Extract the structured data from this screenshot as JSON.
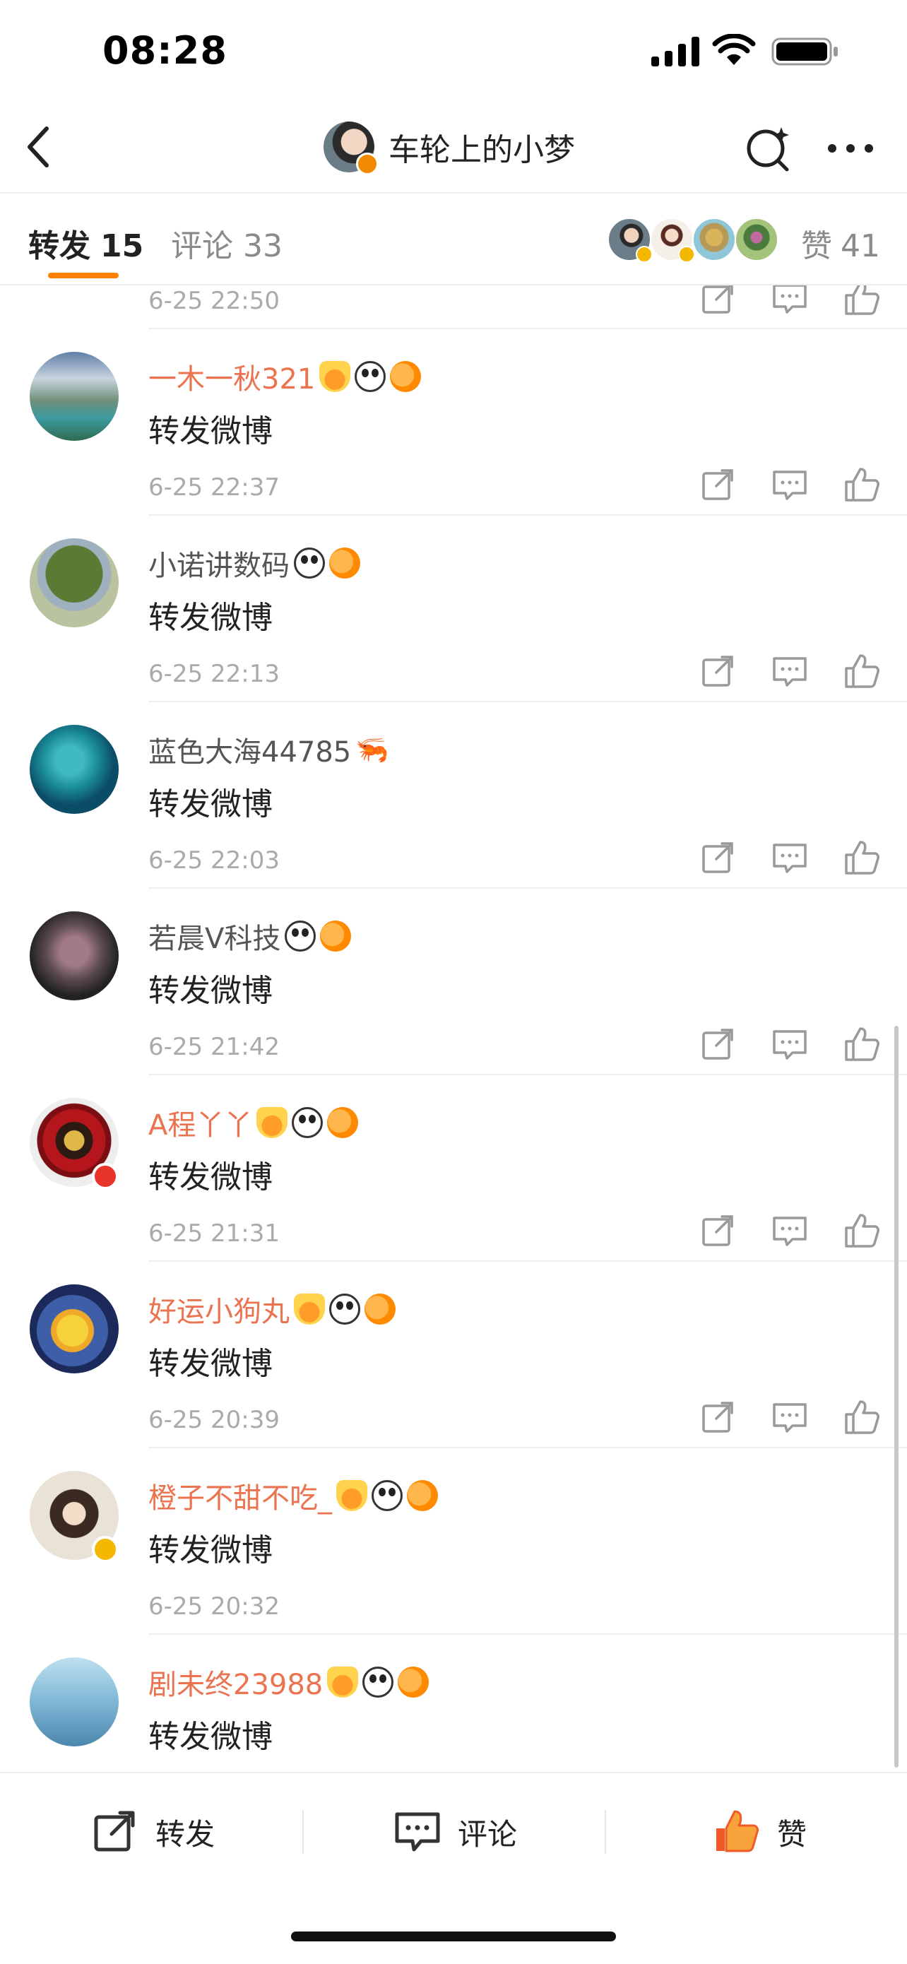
{
  "status_bar": {
    "time": "08:28"
  },
  "nav": {
    "title": "车轮上的小梦"
  },
  "tabs": {
    "repost_label": "转发",
    "repost_count": "15",
    "comment_label": "评论",
    "comment_count": "33",
    "likes_label": "赞",
    "likes_count": "41"
  },
  "partial_item": {
    "time": "6-25 22:50"
  },
  "items": [
    {
      "name": "一木一秋321",
      "content": "转发微博",
      "time": "6-25 22:37"
    },
    {
      "name": "小诺讲数码",
      "content": "转发微博",
      "time": "6-25 22:13"
    },
    {
      "name": "蓝色大海44785",
      "content": "转发微博",
      "time": "6-25 22:03"
    },
    {
      "name": "若晨V科技",
      "content": "转发微博",
      "time": "6-25 21:42"
    },
    {
      "name": "A程丫丫",
      "content": "转发微博",
      "time": "6-25 21:31"
    },
    {
      "name": "好运小狗丸",
      "content": "转发微博",
      "time": "6-25 20:39"
    },
    {
      "name": "橙子不甜不吃_",
      "content": "转发微博",
      "time": "6-25 20:32"
    },
    {
      "name": "剧未终23988",
      "content": "转发微博",
      "time": ""
    }
  ],
  "bottom_bar": {
    "repost": "转发",
    "comment": "评论",
    "like": "赞"
  },
  "colors": {
    "accent": "#ff8200",
    "vip_name": "#eb7350",
    "like_icon": "#f05a28"
  }
}
